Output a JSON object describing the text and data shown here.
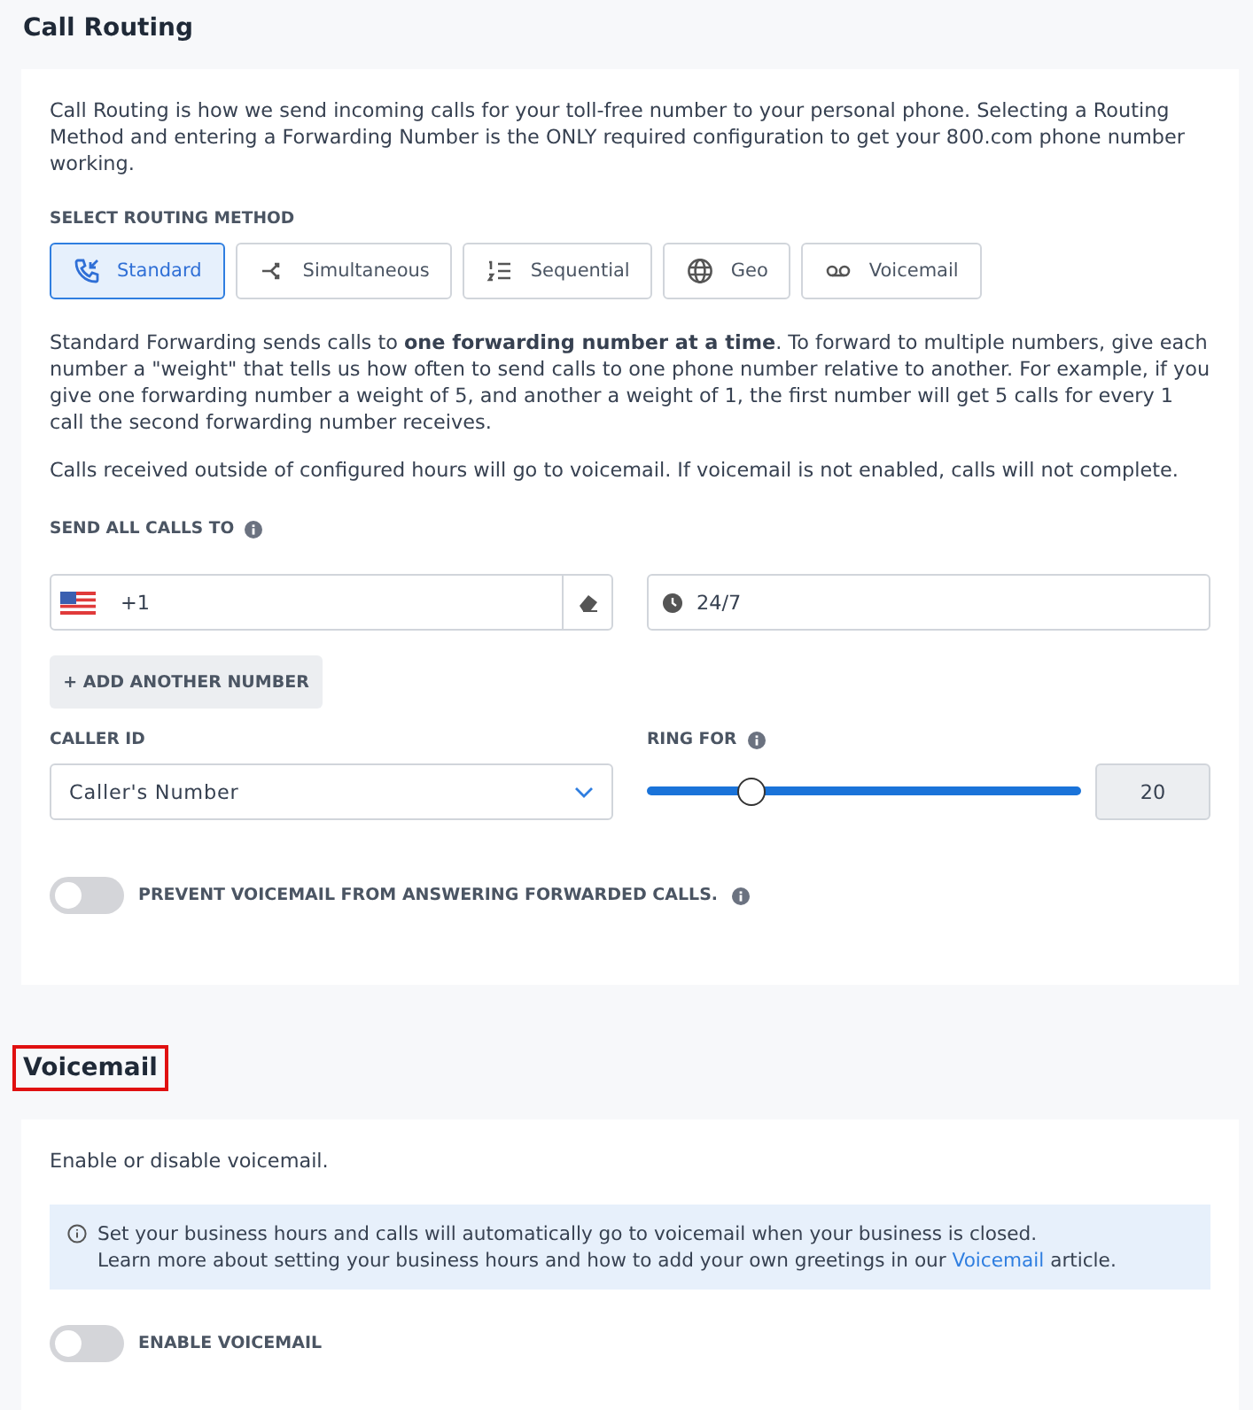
{
  "routing": {
    "title": "Call Routing",
    "intro": "Call Routing is how we send incoming calls for your toll-free number to your personal phone. Selecting a Routing Method and entering a Forwarding Number is the ONLY required configuration to get your 800.com phone number working.",
    "method_label": "SELECT ROUTING METHOD",
    "methods": [
      {
        "label": "Standard",
        "kind": "standard",
        "selected": true
      },
      {
        "label": "Simultaneous",
        "kind": "simultaneous",
        "selected": false
      },
      {
        "label": "Sequential",
        "kind": "sequential",
        "selected": false
      },
      {
        "label": "Geo",
        "kind": "geo",
        "selected": false
      },
      {
        "label": "Voicemail",
        "kind": "voicemail",
        "selected": false
      }
    ],
    "description": "Standard Forwarding sends calls to **one forwarding number at a time**. To forward to multiple numbers, give each number a \"weight\" that tells us how often to send calls to one phone number relative to another. For example, if you give one forwarding number a weight of 5, and another a weight of 1, the first number will get 5 calls for every 1 call the second forwarding number receives.",
    "note": "Calls received outside of configured hours will go to voicemail. If voicemail is not enabled, calls will not complete.",
    "send_label": "SEND ALL CALLS TO",
    "phone": {
      "value": "+1"
    },
    "hours": {
      "value": "24/7"
    },
    "add_button": "+ ADD ANOTHER NUMBER",
    "caller_id": {
      "label": "CALLER ID",
      "value": "Caller's Number"
    },
    "ring_for": {
      "label": "RING FOR",
      "level": 0.24,
      "value": "20"
    },
    "prevent_toggle": {
      "label": "PREVENT VOICEMAIL FROM ANSWERING FORWARDED CALLS.",
      "on": false
    }
  },
  "voicemail": {
    "title": "Voicemail",
    "highlighted": true,
    "intro": "Enable or disable voicemail.",
    "info_line1": "Set your business hours and calls will automatically go to voicemail when your business is closed.",
    "info_line2": {
      "before": "Learn more about setting your business hours and how to add your own greetings in our ",
      "link": "Voicemail",
      "after": " article."
    },
    "toggle": {
      "label": "ENABLE VOICEMAIL",
      "on": false
    }
  }
}
